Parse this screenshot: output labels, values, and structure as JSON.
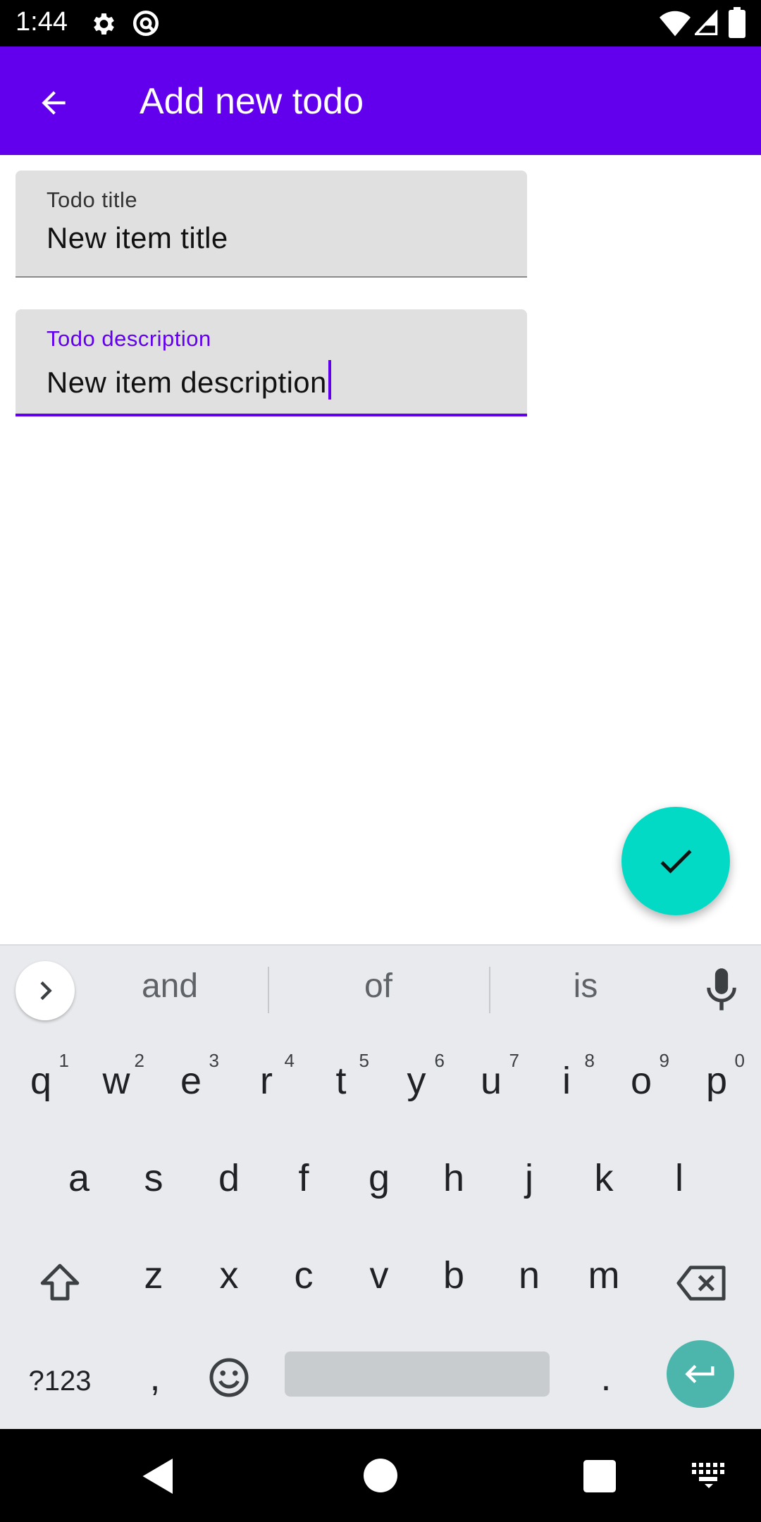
{
  "status_bar": {
    "time": "1:44",
    "icons": [
      "gear-icon",
      "at-ring-icon",
      "wifi-icon",
      "signal-icon",
      "battery-icon"
    ]
  },
  "app_bar": {
    "title": "Add new todo",
    "back_icon": "arrow-back-icon",
    "color": "#6200ee"
  },
  "form": {
    "title_field": {
      "label": "Todo title",
      "value": "New item title",
      "focused": false
    },
    "description_field": {
      "label": "Todo description",
      "value": "New item description",
      "focused": true
    }
  },
  "fab": {
    "icon": "check-icon",
    "color": "#03dac5"
  },
  "keyboard": {
    "suggestions": [
      "and",
      "of",
      "is"
    ],
    "row1": [
      {
        "key": "q",
        "hint": "1"
      },
      {
        "key": "w",
        "hint": "2"
      },
      {
        "key": "e",
        "hint": "3"
      },
      {
        "key": "r",
        "hint": "4"
      },
      {
        "key": "t",
        "hint": "5"
      },
      {
        "key": "y",
        "hint": "6"
      },
      {
        "key": "u",
        "hint": "7"
      },
      {
        "key": "i",
        "hint": "8"
      },
      {
        "key": "o",
        "hint": "9"
      },
      {
        "key": "p",
        "hint": "0"
      }
    ],
    "row2": [
      "a",
      "s",
      "d",
      "f",
      "g",
      "h",
      "j",
      "k",
      "l"
    ],
    "row3": [
      "z",
      "x",
      "c",
      "v",
      "b",
      "n",
      "m"
    ],
    "symbols_label": "?123",
    "comma": ",",
    "period": ".",
    "enter_color": "#4db6ac"
  },
  "nav_bar": {
    "icons": [
      "nav-back-icon",
      "nav-home-icon",
      "nav-recents-icon",
      "keyboard-switch-icon"
    ]
  }
}
